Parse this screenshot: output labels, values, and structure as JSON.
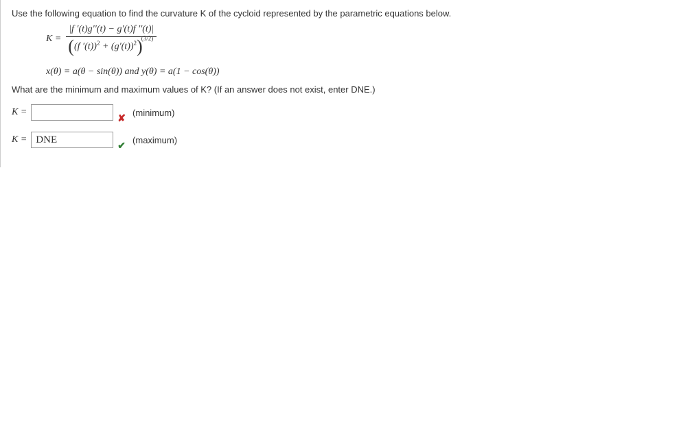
{
  "problem": {
    "intro": "Use the following equation to find the curvature K of the cycloid represented by the parametric equations below.",
    "param_eq": "x(θ) = a(θ − sin(θ))   and   y(θ) = a(1 − cos(θ))",
    "question": "What are the minimum and maximum values of K? (If an answer does not exist, enter DNE.)"
  },
  "formula": {
    "K_equals": "K =",
    "numerator": "|f ′(t)g′′(t) − g′(t)f ′′(t)|",
    "denom_inner": "(f ′(t))",
    "denom_plus": " + (g′(t))",
    "denom_exp_inner": "2",
    "denom_exp_outer": "(3/2)"
  },
  "answers": {
    "min": {
      "k_label": "K =",
      "value": "",
      "status_icon": "✘",
      "label": "(minimum)"
    },
    "max": {
      "k_label": "K =",
      "value": "DNE",
      "status_icon": "✔",
      "label": "(maximum)"
    }
  }
}
